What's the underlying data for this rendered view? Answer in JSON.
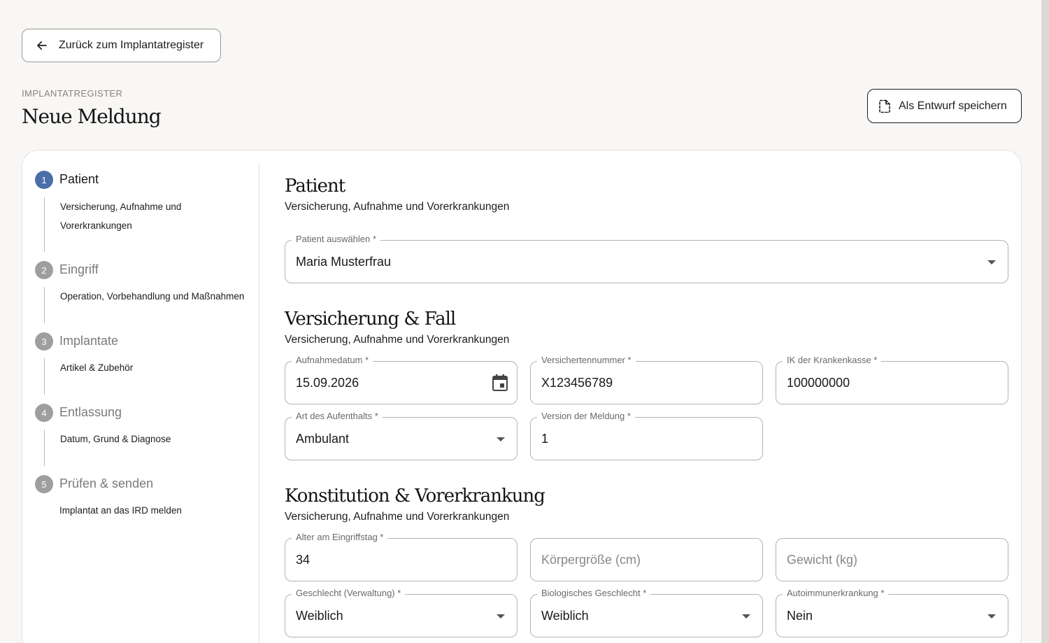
{
  "back_button": {
    "label": "Zurück zum Implantatregister",
    "icon": "arrow-left-icon"
  },
  "header": {
    "overline": "IMPLANTATREGISTER",
    "title": "Neue Meldung",
    "draft_button": {
      "label": "Als Entwurf speichern",
      "icon": "draft-document-icon"
    }
  },
  "stepper": [
    {
      "number": "1",
      "label": "Patient",
      "description": "Versicherung, Aufnahme und Vorerkrankungen",
      "active": true
    },
    {
      "number": "2",
      "label": "Eingriff",
      "description": "Operation, Vorbehandlung und Maßnahmen",
      "active": false
    },
    {
      "number": "3",
      "label": "Implantate",
      "description": "Artikel & Zubehör",
      "active": false
    },
    {
      "number": "4",
      "label": "Entlassung",
      "description": "Datum, Grund & Diagnose",
      "active": false
    },
    {
      "number": "5",
      "label": "Prüfen & senden",
      "description": "Implantat an das IRD melden",
      "active": false
    }
  ],
  "sections": {
    "patient": {
      "title": "Patient",
      "subtitle": "Versicherung, Aufnahme und Vorerkrankungen",
      "patient_select": {
        "label": "Patient auswählen *",
        "value": "Maria Musterfrau"
      }
    },
    "insurance": {
      "title": "Versicherung & Fall",
      "subtitle": "Versicherung, Aufnahme und Vorerkrankungen",
      "admission_date": {
        "label": "Aufnahmedatum *",
        "value": "15.09.2026"
      },
      "insurance_number": {
        "label": "Versichertennummer *",
        "value": "X123456789"
      },
      "ik_number": {
        "label": "IK der Krankenkasse *",
        "value": "100000000"
      },
      "stay_type": {
        "label": "Art des Aufenthalts *",
        "value": "Ambulant"
      },
      "report_version": {
        "label": "Version der Meldung *",
        "value": "1"
      }
    },
    "constitution": {
      "title": "Konstitution & Vorerkrankung",
      "subtitle": "Versicherung, Aufnahme und Vorerkrankungen",
      "age": {
        "label": "Alter am Eingriffstag *",
        "value": "34"
      },
      "height": {
        "placeholder": "Körpergröße (cm)"
      },
      "weight": {
        "placeholder": "Gewicht (kg)"
      },
      "gender_admin": {
        "label": "Geschlecht (Verwaltung) *",
        "value": "Weiblich"
      },
      "gender_bio": {
        "label": "Biologisches Geschlecht *",
        "value": "Weiblich"
      },
      "autoimmune": {
        "label": "Autoimmunerkrankung *",
        "value": "Nein"
      }
    }
  },
  "colors": {
    "accent": "#4a6ea9",
    "step_inactive": "#9e9e9e"
  }
}
